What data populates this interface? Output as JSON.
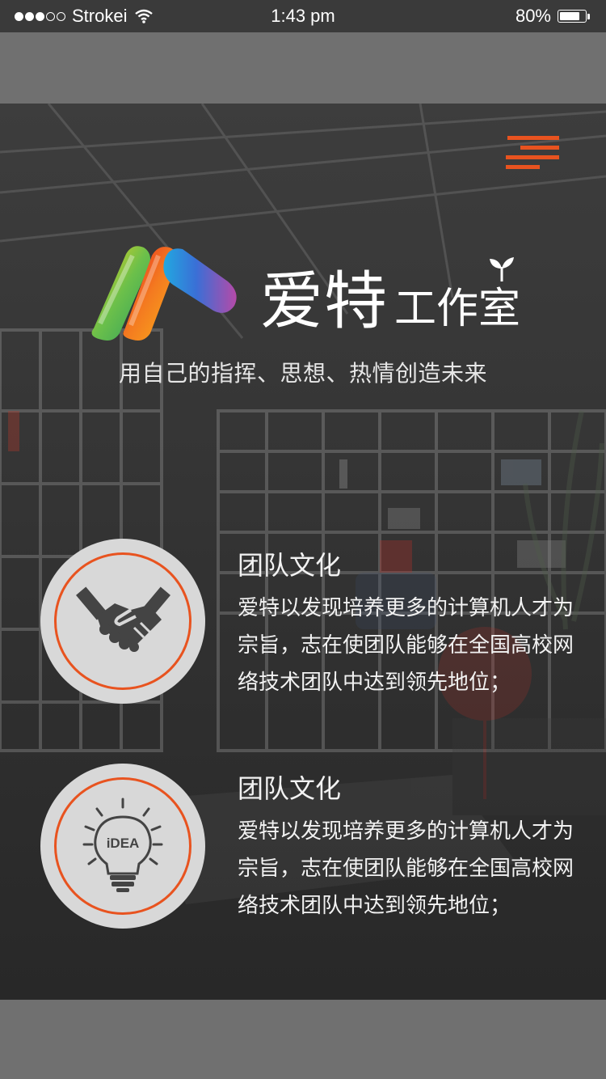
{
  "status_bar": {
    "carrier": "Strokei",
    "time": "1:43 pm",
    "battery_percent": "80%",
    "battery_level": 0.8,
    "signal_bars_filled": 3,
    "signal_bars_total": 5
  },
  "header": {
    "brand_primary": "爱特",
    "brand_secondary": "工作室",
    "tagline": "用自己的指挥、思想、热情创造未来"
  },
  "features": [
    {
      "title": "团队文化",
      "description": "爱特以发现培养更多的计算机人才为宗旨，志在使团队能够在全国高校网络技术团队中达到领先地位；",
      "icon": "handshake-icon"
    },
    {
      "title": "团队文化",
      "description": "爱特以发现培养更多的计算机人才为宗旨，志在使团队能够在全国高校网络技术团队中达到领先地位；",
      "icon": "idea-bulb-icon",
      "icon_text": "iDEA"
    }
  ],
  "colors": {
    "accent": "#e8531f",
    "status_bar": "#3a3a3a",
    "page_grey": "#707070",
    "icon_circle": "#d8d8d8"
  }
}
